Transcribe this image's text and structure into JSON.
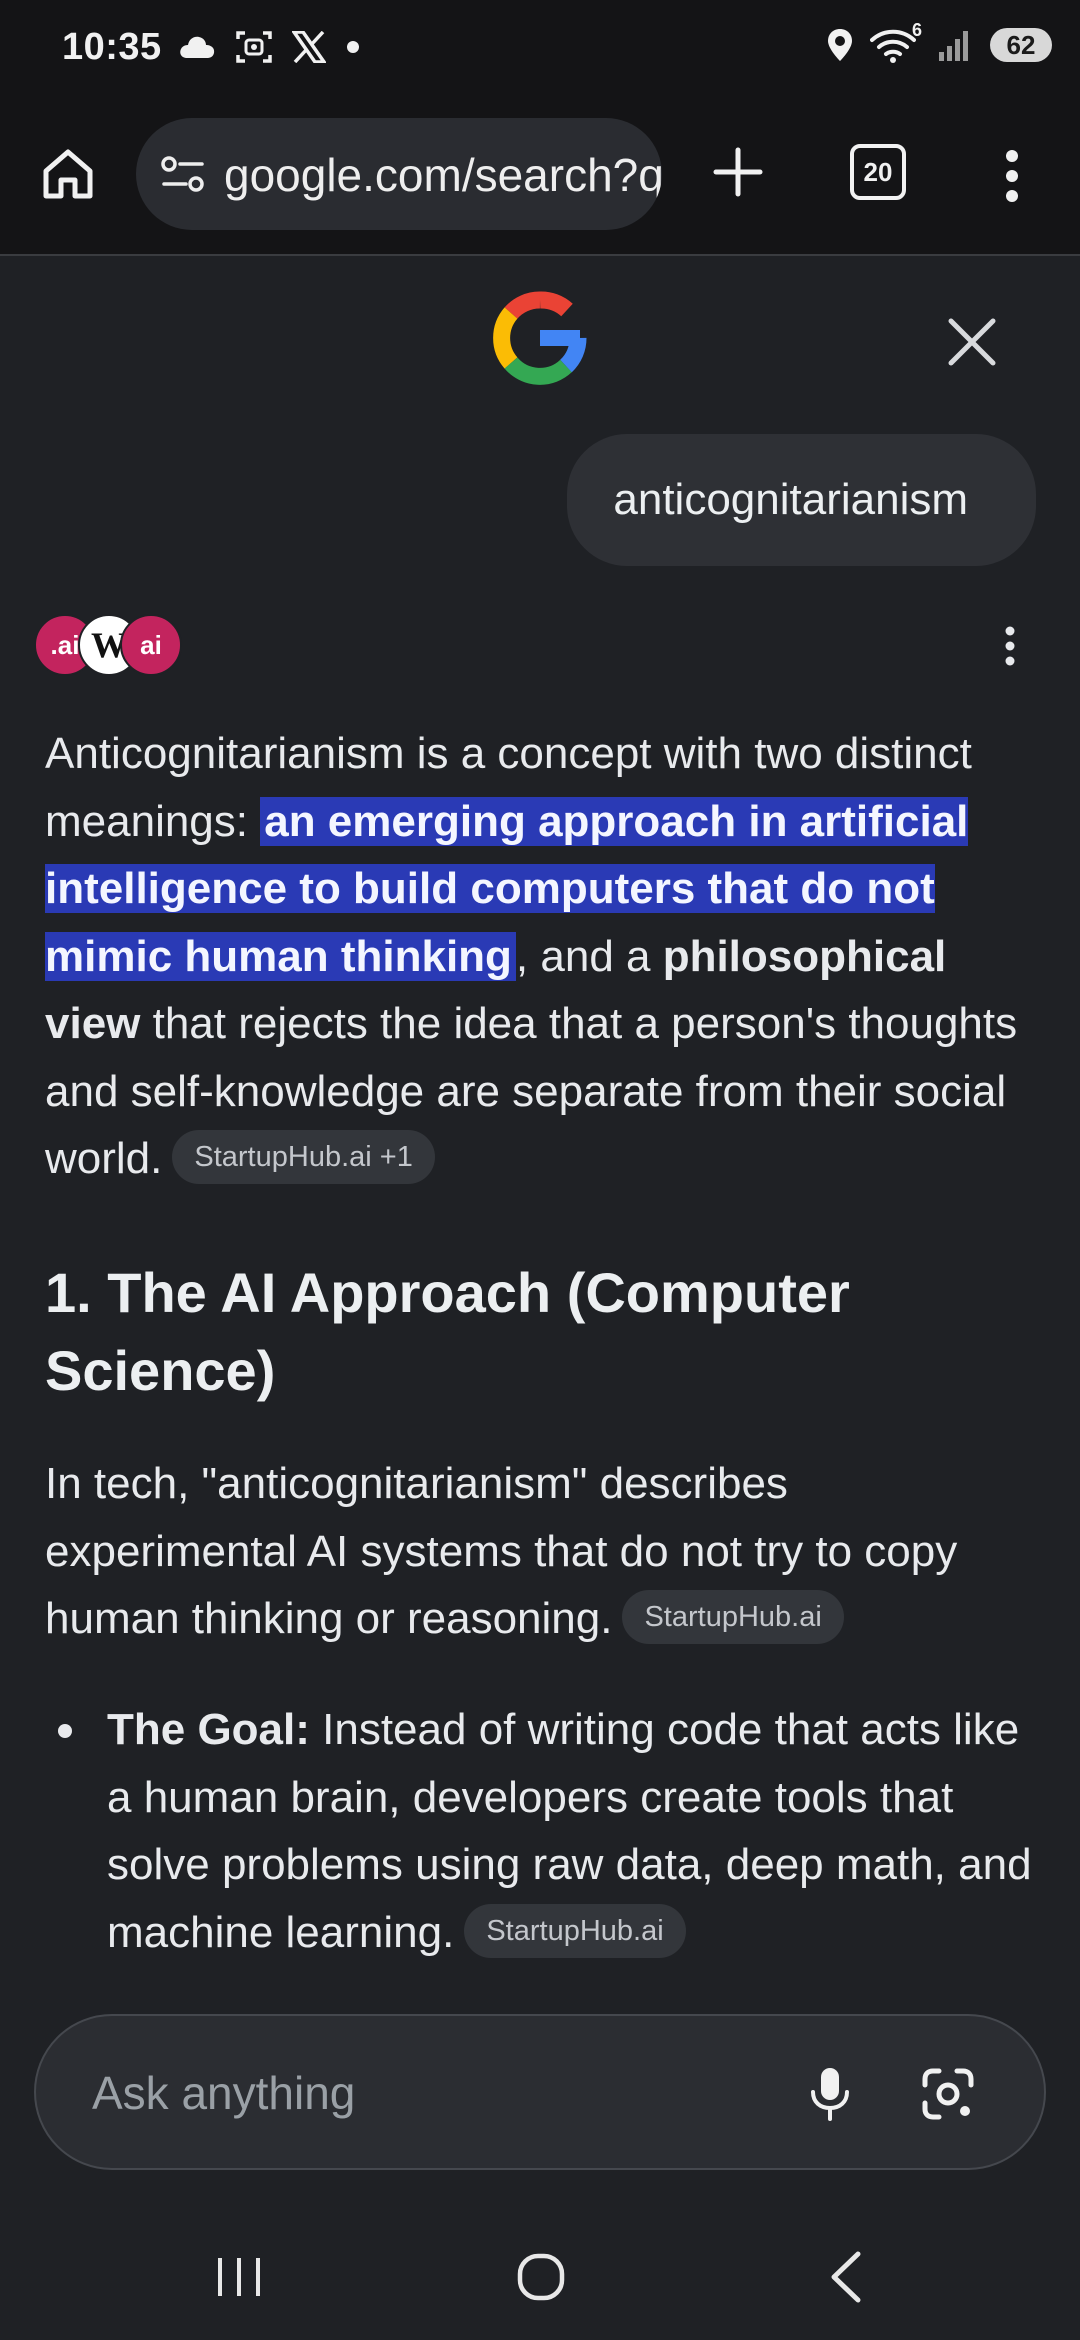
{
  "status_bar": {
    "time": "10:35",
    "battery": "62",
    "notification_icons": [
      "cloud-icon",
      "screenshot-icon",
      "x-app-icon",
      "dot-icon"
    ],
    "system_icons": [
      "location-icon",
      "wifi-icon",
      "signal-icon",
      "battery-icon"
    ],
    "wifi_badge": "6"
  },
  "browser": {
    "url": "google.com/search?q=anticognitarianism",
    "tab_count": "20"
  },
  "query": "anticognitarianism",
  "sources": [
    ".ai",
    "W",
    "ai"
  ],
  "answer": {
    "intro_before": "Anticognitarianism is a concept with two distinct meanings: ",
    "intro_highlight": "an emerging approach in artificial intelligence to build computers that do not mimic human thinking",
    "intro_middle": ", and a ",
    "intro_bold": "philosophical view",
    "intro_after": " that rejects the idea that a person's thoughts and self-knowledge are separate from their social world.",
    "intro_chip": "StartupHub.ai +1",
    "section_heading": "1. The AI Approach (Computer Science)",
    "para2_text": "In tech, \"anticognitarianism\" describes experimental AI systems that do not try to copy human thinking or reasoning.",
    "para2_chip": "StartupHub.ai",
    "bullet_label": "The Goal:",
    "bullet_text": " Instead of writing code that acts like a human brain, developers create tools that solve problems using raw data, deep math, and machine learning.",
    "bullet_chip": "StartupHub.ai"
  },
  "ask_bar": {
    "placeholder": "Ask anything"
  },
  "colors": {
    "background": "#1f2125",
    "highlight": "#2a3ab5",
    "chip": "#33363b",
    "source_brand": "#c3245e"
  }
}
